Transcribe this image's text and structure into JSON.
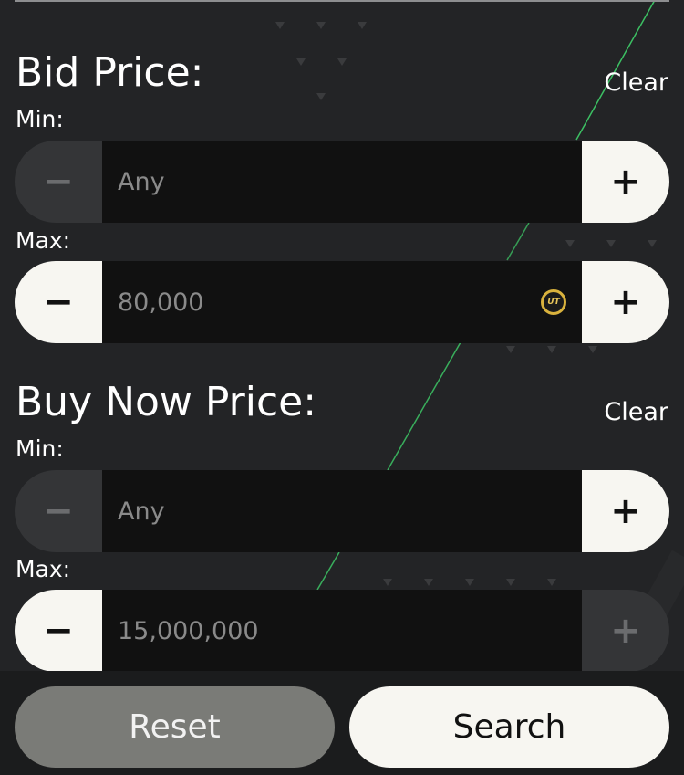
{
  "bid_price": {
    "title": "Bid Price:",
    "clear_label": "Clear",
    "min": {
      "label": "Min:",
      "value": "Any",
      "minus": "−",
      "plus": "+"
    },
    "max": {
      "label": "Max:",
      "value": "80,000",
      "minus": "−",
      "plus": "+",
      "coin_text": "UT"
    }
  },
  "buy_now_price": {
    "title": "Buy Now Price:",
    "clear_label": "Clear",
    "min": {
      "label": "Min:",
      "value": "Any",
      "minus": "−",
      "plus": "+"
    },
    "max": {
      "label": "Max:",
      "value": "15,000,000",
      "minus": "−",
      "plus": "+"
    }
  },
  "actions": {
    "reset_label": "Reset",
    "search_label": "Search"
  },
  "colors": {
    "background": "#232426",
    "input_bg": "#111111",
    "button_light": "#f7f6f1",
    "button_disabled": "#343537",
    "reset_bg": "#7a7b77",
    "accent_line": "#3fd16a",
    "coin_gold": "#d9b23d"
  }
}
